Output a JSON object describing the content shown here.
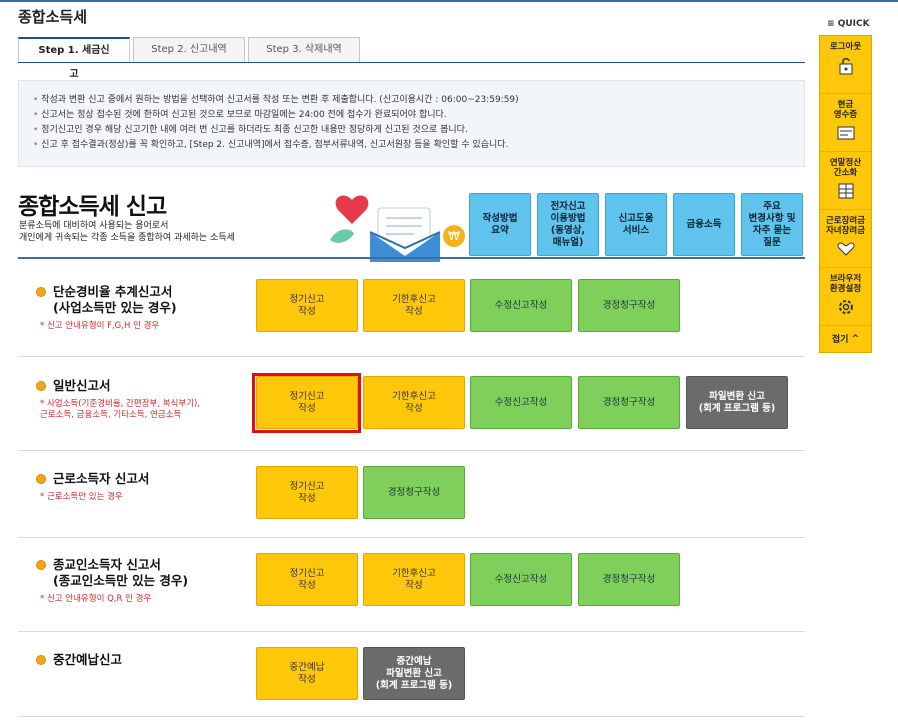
{
  "page": {
    "title": "종합소득세"
  },
  "tabs": [
    "Step 1. 세금신고",
    "Step 2. 신고내역",
    "Step 3. 삭제내역"
  ],
  "notices": [
    "작성과 변환 신고 중에서 원하는 방법을 선택하여 신고서를 작성 또는 변환 후 제출합니다. (신고이용시간 : 06:00~23:59:59)",
    "신고서는 정상 접수된 것에 한하여 신고된 것으로 보므로 마감일에는 24:00 전에 접수가 완료되어야 합니다.",
    "정기신고인 경우 해당 신고기한 내에 여러 번 신고를 하더라도 최종 신고한 내용만 정당하게 신고된 것으로 봅니다.",
    "신고 후 접수결과(정상)를 꼭 확인하고, [Step 2. 신고내역]에서 접수증, 첨부서류내역, 신고서원장 등을 확인할 수 있습니다."
  ],
  "hero": {
    "title": "종합소득세 신고",
    "desc1": "분류소득에 대비하여 사용되는 용어로서",
    "desc2": "개인에게 귀속되는 각종 소득을 종합하여 과세하는 소득세"
  },
  "quick_buttons": [
    "작성방법\n요약",
    "전자신고\n이용방법\n(동영상,\n매뉴얼)",
    "신고도움\n서비스",
    "금융소득",
    "주요\n변경사항 및\n자주 묻는\n질문"
  ],
  "sections": [
    {
      "title": "단순경비율 추계신고서",
      "title2": "(사업소득만 있는 경우)",
      "note": "* 신고 안내유형이 F,G,H 인 경우",
      "note2": ""
    },
    {
      "title": "일반신고서",
      "title2": "",
      "note": "* 사업소득(기준경비율, 간편장부, 복식부기),",
      "note2": "근로소득, 금융소득, 기타소득, 연금소득"
    },
    {
      "title": "근로소득자 신고서",
      "title2": "",
      "note": "* 근로소득만 있는 경우",
      "note2": ""
    },
    {
      "title": "종교인소득자 신고서",
      "title2": "(종교인소득만 있는 경우)",
      "note": "* 신고 안내유형이 Q,R 인 경우",
      "note2": ""
    },
    {
      "title": "중간예납신고",
      "title2": "",
      "note": "",
      "note2": ""
    }
  ],
  "buttons": {
    "regular": "정기신고\n작성",
    "late": "기한후신고\n작성",
    "amend": "수정신고작성",
    "claim": "경정청구작성",
    "convert": "파일변환 신고\n(회계 프로그램 등)",
    "interim": "중간예납\n작성",
    "interim_convert": "중간예납\n파일변환 신고\n(회계 프로그램 등)"
  },
  "quick_menu": {
    "header": "QUICK",
    "items": [
      "로그아웃",
      "현금\n영수증",
      "연말정산\n간소화",
      "근로장려금\n자녀장려금",
      "브라우저\n환경설정"
    ],
    "close": "접기"
  },
  "colors": {
    "accent": "#ffc70a",
    "green": "#7ed05a",
    "sky": "#5fc3ee",
    "highlight": "#e01010"
  }
}
